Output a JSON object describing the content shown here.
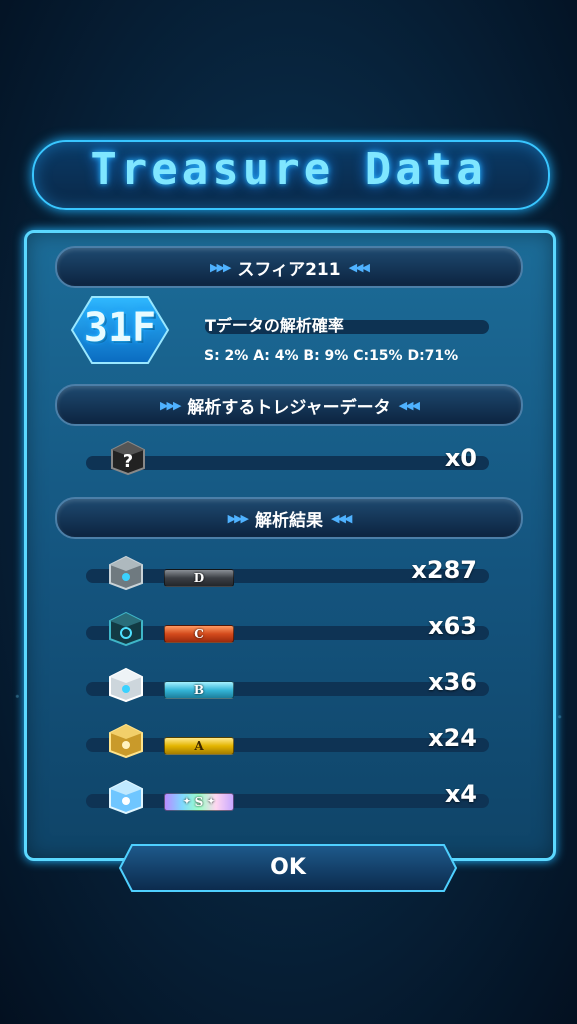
{
  "title": "Treasure Data",
  "sphere": {
    "label": "スフィア211"
  },
  "floor": "31F",
  "analysis_rate": {
    "label": "Tデータの解析確率",
    "values": "S: 2%  A: 4%  B: 9%  C:15%  D:71%"
  },
  "analyze_section": {
    "label": "解析するトレジャーデータ",
    "count": "x0"
  },
  "results_section": {
    "label": "解析結果",
    "rows": [
      {
        "grade": "D",
        "count": "x287"
      },
      {
        "grade": "C",
        "count": "x63"
      },
      {
        "grade": "B",
        "count": "x36"
      },
      {
        "grade": "A",
        "count": "x24"
      },
      {
        "grade": "S",
        "count": "x4"
      }
    ]
  },
  "ok_button": {
    "label": "OK"
  },
  "colors": {
    "accent": "#39c6ff",
    "panel": "#1a6590",
    "grade_d": "#3b3f45",
    "grade_c": "#d34a1c",
    "grade_b": "#35b6d8",
    "grade_a": "#e3b400",
    "grade_s": "#b88cff"
  },
  "icons": {
    "unknown_cube": "question-cube-icon",
    "d_cube": "silver-cube-icon",
    "c_cube": "dark-teal-cube-icon",
    "b_cube": "white-cube-icon",
    "a_cube": "gold-cube-icon",
    "s_cube": "crystal-cube-icon"
  }
}
